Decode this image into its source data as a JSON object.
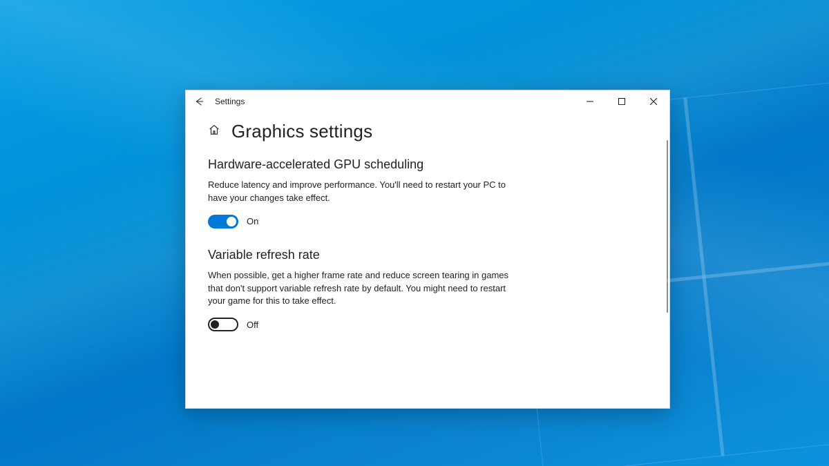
{
  "window": {
    "title": "Settings"
  },
  "page": {
    "title": "Graphics settings"
  },
  "sections": {
    "gpu": {
      "title": "Hardware-accelerated GPU scheduling",
      "description": "Reduce latency and improve performance. You'll need to restart your PC to have your changes take effect.",
      "toggle_state": "On"
    },
    "vrr": {
      "title": "Variable refresh rate",
      "description": "When possible, get a higher frame rate and reduce screen tearing in games that don't support variable refresh rate by default. You might need to restart your game for this to take effect.",
      "toggle_state": "Off"
    }
  }
}
